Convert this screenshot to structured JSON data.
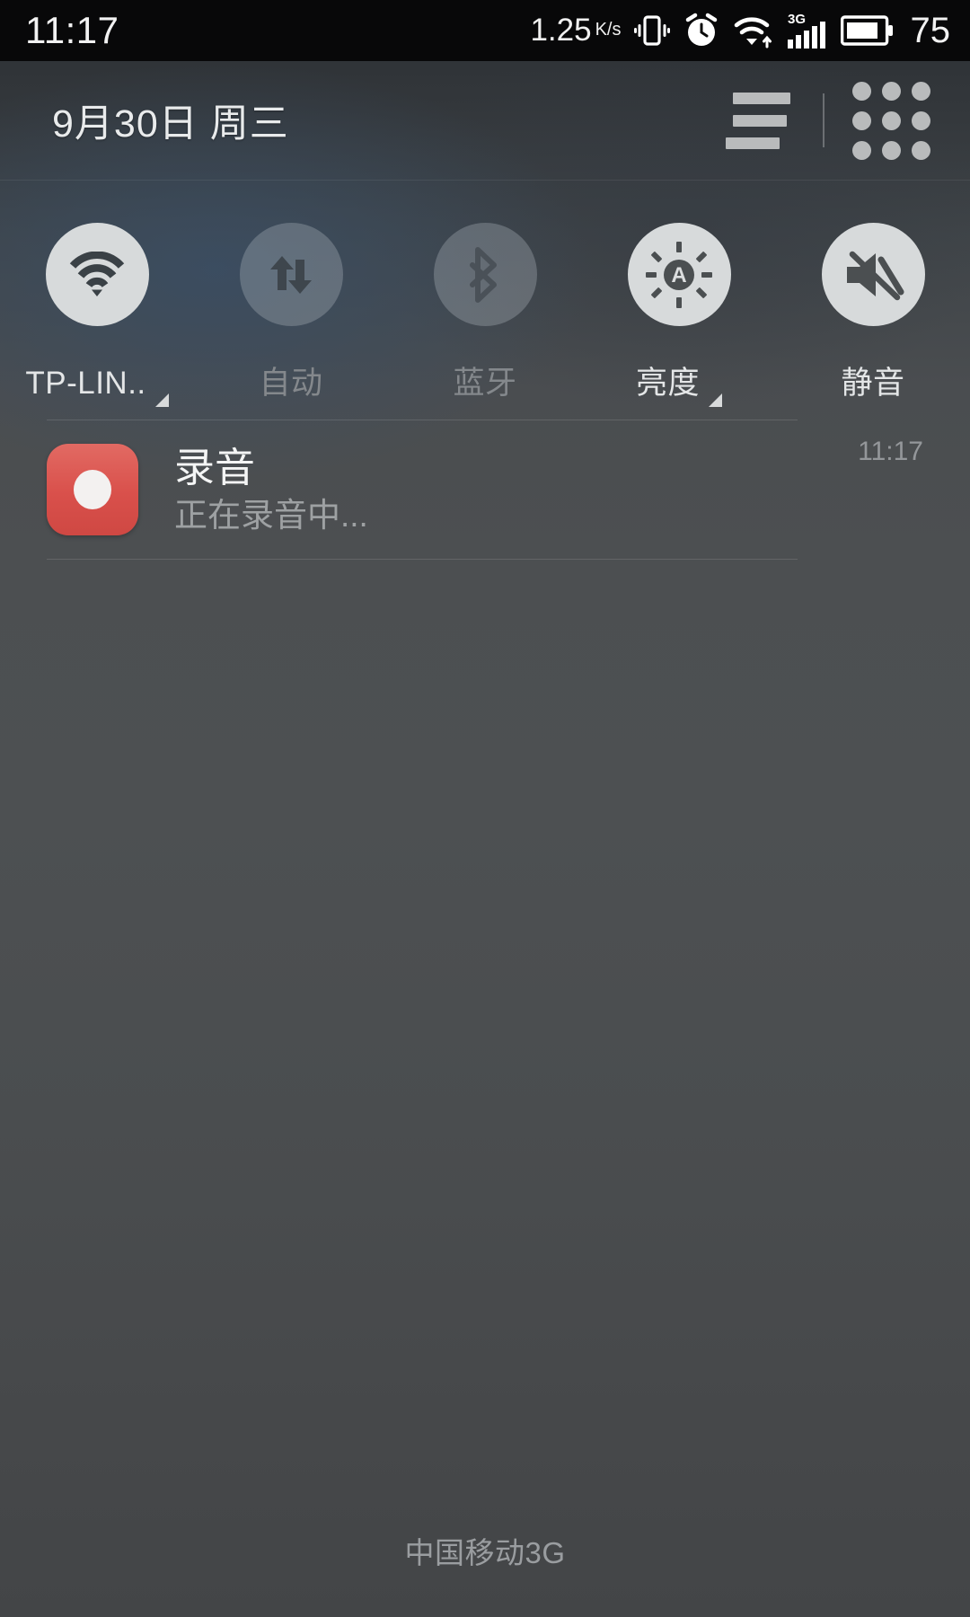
{
  "status_bar": {
    "clock": "11:17",
    "network_speed_value": "1.25",
    "network_speed_unit": "K/s",
    "battery_percent": "75",
    "icons": [
      "vibrate-icon",
      "alarm-icon",
      "wifi-icon",
      "signal-3g-icon",
      "battery-icon"
    ]
  },
  "header": {
    "date": "9月30日  周三",
    "list_button": "list-view-button",
    "grid_button": "grid-view-button"
  },
  "quick_settings": {
    "tiles": [
      {
        "id": "wifi",
        "label": "TP-LIN..",
        "icon": "wifi-icon",
        "active": true,
        "has_caret": true
      },
      {
        "id": "mobile_data",
        "label": "自动",
        "icon": "data-sync-icon",
        "active": false,
        "has_caret": false
      },
      {
        "id": "bluetooth",
        "label": "蓝牙",
        "icon": "bluetooth-icon",
        "active": false,
        "has_caret": false
      },
      {
        "id": "brightness",
        "label": "亮度",
        "icon": "brightness-auto-icon",
        "active": true,
        "has_caret": true
      },
      {
        "id": "mute",
        "label": "静音",
        "icon": "volume-mute-icon",
        "active": true,
        "has_caret": false
      }
    ]
  },
  "notifications": [
    {
      "app_icon": "record-icon",
      "title": "录音",
      "subtitle": "正在录音中...",
      "time": "11:17",
      "accent_color": "#d9504b"
    }
  ],
  "footer": {
    "carrier": "中国移动3G"
  }
}
